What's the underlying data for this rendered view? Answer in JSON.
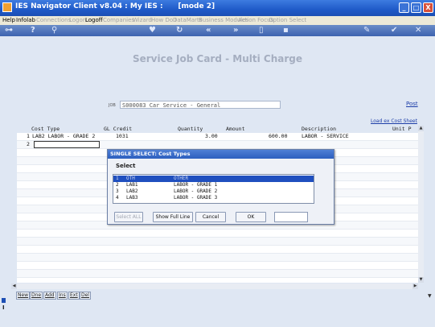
{
  "window": {
    "title": "IES Navigator Client v8.04 : My IES :      [mode 2]",
    "app_icon": "ies-app-icon",
    "buttons": [
      "_",
      "□",
      "X"
    ]
  },
  "menubar": {
    "items": [
      {
        "label": "Help",
        "enabled": true
      },
      {
        "label": "Infolab",
        "enabled": true
      },
      {
        "label": "Connections",
        "enabled": false
      },
      {
        "label": "Logon",
        "enabled": false
      },
      {
        "label": "Logoff",
        "enabled": true
      },
      {
        "label": "Companies",
        "enabled": false
      },
      {
        "label": "Wizard",
        "enabled": false
      },
      {
        "label": "How Do I",
        "enabled": false
      },
      {
        "label": "DataMarts",
        "enabled": false
      },
      {
        "label": "Business Modules",
        "enabled": false
      },
      {
        "label": "Action Focus",
        "enabled": false
      },
      {
        "label": "Option Select",
        "enabled": false
      }
    ]
  },
  "toolbar": {
    "icons": [
      "key-icon",
      "help-icon",
      "search-icon",
      "heart-icon",
      "refresh-icon",
      "back-icon",
      "forward-icon",
      "document-icon",
      "print-icon",
      "tools-icon",
      "check-icon",
      "close-icon"
    ]
  },
  "form": {
    "title": "Service Job Card - Multi Charge",
    "job_tag": "JOB",
    "job_value": "S000083 Car Service - General",
    "post_link": "Post",
    "load_link": "Load ex Cost Sheet"
  },
  "grid": {
    "columns": [
      "Cost Type",
      "GL Credit",
      "Quantity",
      "Amount",
      "Description",
      "Unit P"
    ],
    "rows": [
      {
        "num": "1",
        "cost_type": "LAB2 LABOR - GRADE 2",
        "gl_credit": "1031",
        "quantity": "3.00",
        "amount": "600.00",
        "description": "LABOR - SERVICE"
      },
      {
        "num": "2",
        "cost_type": "",
        "gl_credit": "",
        "quantity": "",
        "amount": "",
        "description": ""
      }
    ]
  },
  "row_buttons": [
    "New",
    "Dne",
    "Add",
    "Ins",
    "Ext",
    "Del"
  ],
  "dialog": {
    "title": "SINGLE SELECT: Cost Types",
    "select_label": "Select",
    "options": [
      {
        "num": "1",
        "code": "OTH",
        "name": "OTHER"
      },
      {
        "num": "2",
        "code": "LAB1",
        "name": "LABOR - GRADE 1"
      },
      {
        "num": "3",
        "code": "LAB2",
        "name": "LABOR - GRADE 2"
      },
      {
        "num": "4",
        "code": "LAB3",
        "name": "LABOR - GRADE 3"
      }
    ],
    "selected_index": 0,
    "buttons": {
      "select_all": "Select ALL",
      "show_full_line": "Show Full Line",
      "cancel": "Cancel",
      "ok": "OK"
    }
  }
}
